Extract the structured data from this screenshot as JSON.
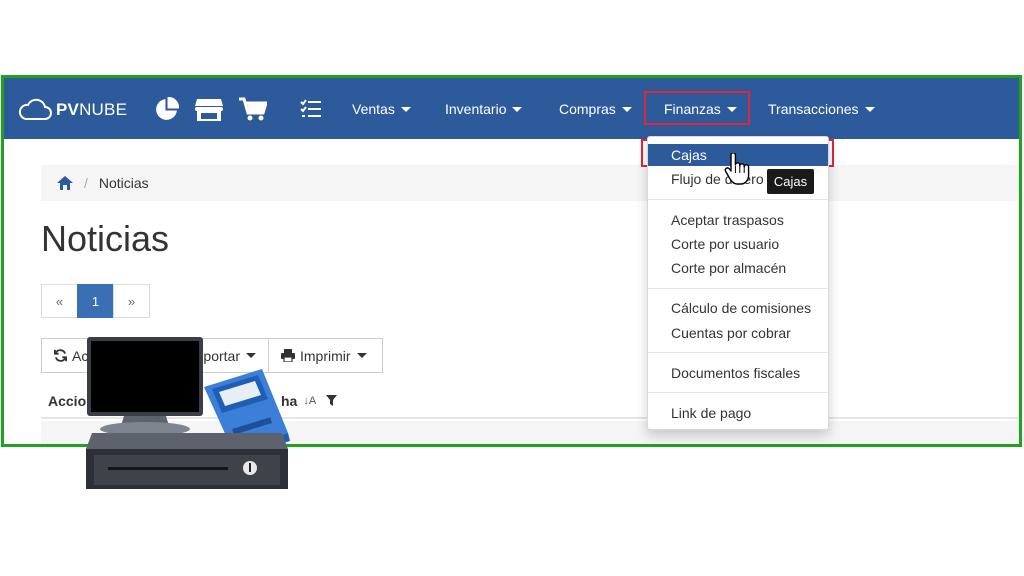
{
  "brand": {
    "logo_bold": "PV",
    "logo_light": "NUBE"
  },
  "navbar": {
    "icons": [
      "pie-chart-icon",
      "store-icon",
      "shopping-cart-icon",
      "task-list-icon"
    ],
    "menus": [
      {
        "label": "Ventas"
      },
      {
        "label": "Inventario"
      },
      {
        "label": "Compras"
      },
      {
        "label": "Finanzas"
      },
      {
        "label": "Transacciones"
      }
    ]
  },
  "finanzas_dropdown": {
    "items": [
      {
        "label": "Cajas",
        "active": true
      },
      {
        "label": "Flujo de dinero"
      },
      {
        "label": "Aceptar traspasos"
      },
      {
        "label": "Corte por usuario"
      },
      {
        "label": "Corte por almacén"
      },
      {
        "label": "Cálculo de comisiones"
      },
      {
        "label": "Cuentas por cobrar"
      },
      {
        "label": "Documentos fiscales"
      },
      {
        "label": "Link de pago"
      }
    ],
    "tooltip": "Cajas"
  },
  "breadcrumb": {
    "home_icon": "home-icon",
    "current": "Noticias"
  },
  "page": {
    "title": "Noticias"
  },
  "pagination": {
    "prev": "«",
    "current": "1",
    "next": "»"
  },
  "toolbar": {
    "refresh_label": "Ac",
    "export_label": "portar",
    "print_label": "Imprimir"
  },
  "table": {
    "col_acciones": "Accio",
    "col_fecha": "ha",
    "sort_glyph": "↓A"
  },
  "colors": {
    "navbar": "#2d5a9a",
    "frame_border": "#1fa31f",
    "highlight_border": "#e0263a",
    "active_item": "#2d5a9a"
  }
}
